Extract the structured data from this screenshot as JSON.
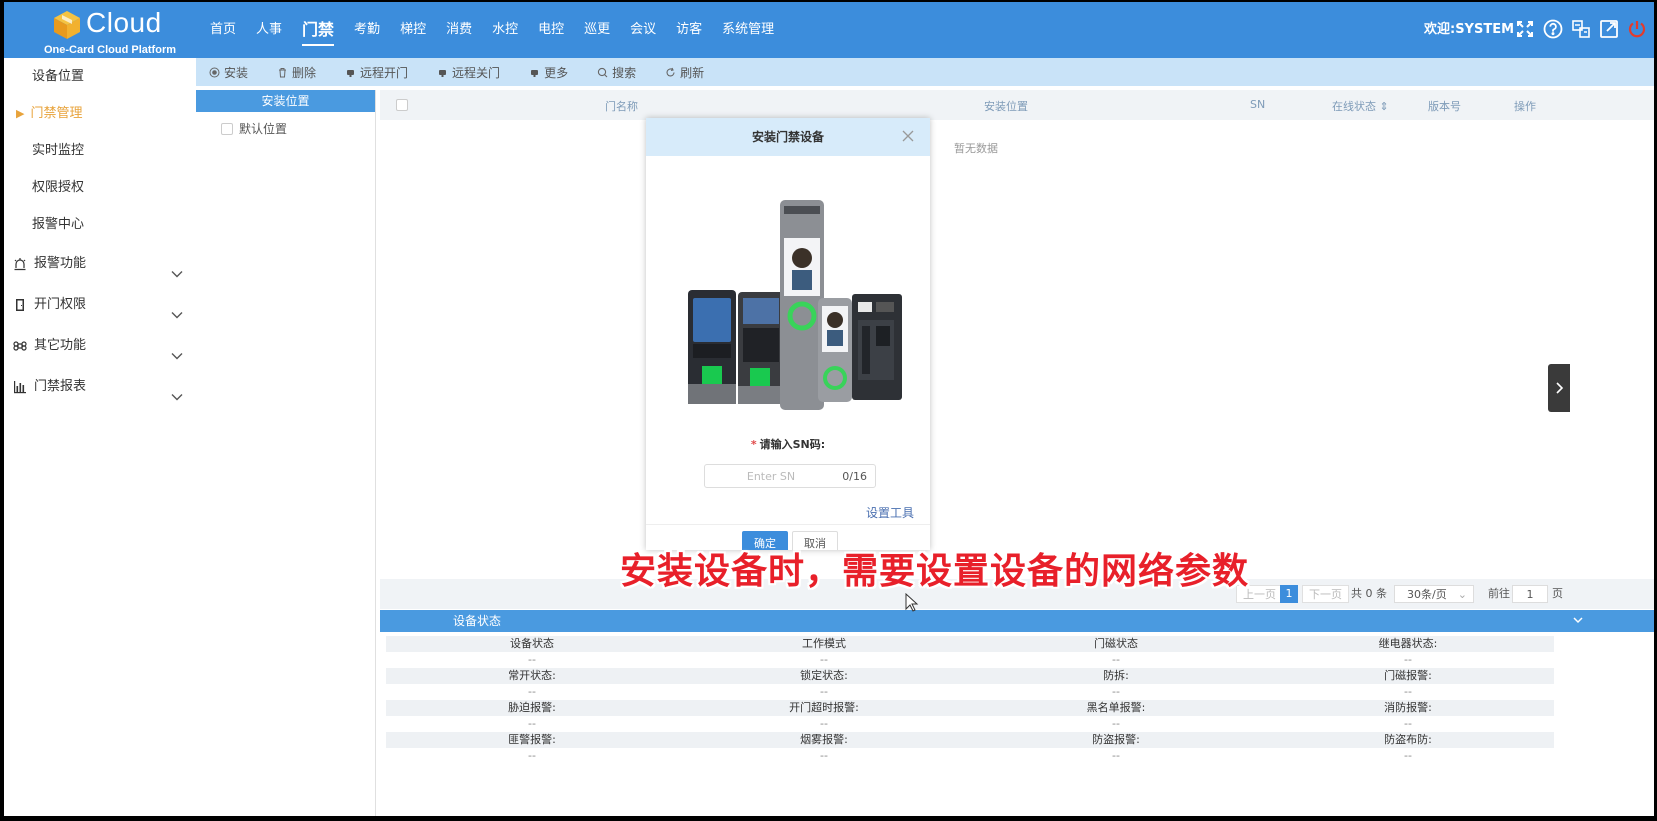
{
  "header": {
    "logo_text": "Cloud",
    "logo_subtitle": "One-Card Cloud Platform",
    "nav": [
      "首页",
      "人事",
      "门禁",
      "考勤",
      "梯控",
      "消费",
      "水控",
      "电控",
      "巡更",
      "会议",
      "访客",
      "系统管理"
    ],
    "active_nav_index": 2,
    "welcome": "欢迎:SYSTEM",
    "icons": [
      "fullscreen-icon",
      "help-icon",
      "switch-icon",
      "external-link-icon",
      "power-icon"
    ]
  },
  "sidebar": {
    "sub_items": [
      "设备位置",
      "门禁管理",
      "实时监控",
      "权限授权",
      "报警中心"
    ],
    "active_sub_index": 1,
    "groups": [
      {
        "label": "报警功能",
        "icon": "alarm-icon"
      },
      {
        "label": "开门权限",
        "icon": "door-icon"
      },
      {
        "label": "其它功能",
        "icon": "command-icon"
      },
      {
        "label": "门禁报表",
        "icon": "report-chart-icon"
      }
    ]
  },
  "toolbar": {
    "buttons": [
      {
        "label": "安装",
        "icon": "install-icon"
      },
      {
        "label": "删除",
        "icon": "trash-icon"
      },
      {
        "label": "远程开门",
        "icon": "remote-open-icon"
      },
      {
        "label": "远程关门",
        "icon": "remote-close-icon"
      },
      {
        "label": "更多",
        "icon": "more-icon"
      },
      {
        "label": "搜索",
        "icon": "search-icon"
      },
      {
        "label": "刷新",
        "icon": "refresh-icon"
      }
    ]
  },
  "location_panel": {
    "title": "安装位置",
    "items": [
      "默认位置"
    ]
  },
  "table": {
    "columns": [
      "门名称",
      "安装位置",
      "SN",
      "在线状态",
      "版本号",
      "操作"
    ],
    "empty_text": "暂无数据"
  },
  "pager": {
    "prev": "上一页",
    "current": "1",
    "next": "下一页",
    "total": "共 0 条",
    "page_size": "30条/页",
    "goto_label": "前往",
    "goto_value": "1",
    "page_suffix": "页"
  },
  "status_panel": {
    "title": "设备状态",
    "rows": [
      [
        "设备状态",
        "工作模式",
        "门磁状态",
        "继电器状态:"
      ],
      [
        "常开状态:",
        "锁定状态:",
        "防拆:",
        "门磁报警:"
      ],
      [
        "胁迫报警:",
        "开门超时报警:",
        "黑名单报警:",
        "消防报警:"
      ],
      [
        "匪警报警:",
        "烟雾报警:",
        "防盗报警:",
        "防盗布防:"
      ]
    ],
    "empty_value": "--"
  },
  "modal": {
    "title": "安装门禁设备",
    "sn_label": "请输入SN码:",
    "sn_required_mark": "*",
    "sn_placeholder": "Enter SN",
    "sn_value": "",
    "sn_counter": "0/16",
    "set_tool": "设置工具",
    "ok": "确定",
    "cancel": "取消"
  },
  "caption": "安装设备时，需要设置设备的网络参数",
  "colors": {
    "header_bg": "#3c8ddc",
    "active_menu": "#e8a33b",
    "caption": "#e8202a"
  }
}
